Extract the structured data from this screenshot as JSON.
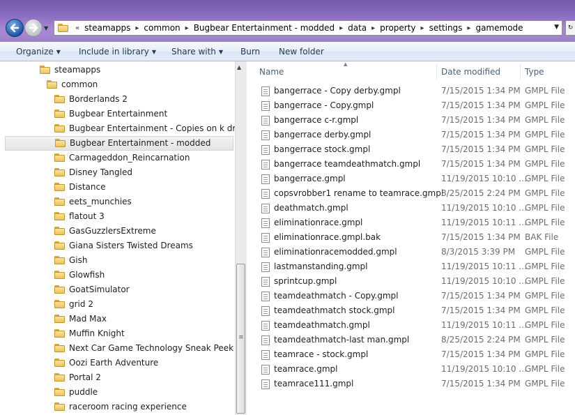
{
  "address": {
    "overflow_chevron": "«",
    "crumbs": [
      "steamapps",
      "common",
      "Bugbear Entertainment - modded",
      "data",
      "property",
      "settings",
      "gamemode"
    ]
  },
  "toolbar": {
    "organize": "Organize",
    "include_in_library": "Include in library",
    "share_with": "Share with",
    "burn": "Burn",
    "new_folder": "New folder"
  },
  "nav": {
    "items": [
      "steamapps",
      "common",
      "Borderlands 2",
      "Bugbear Entertainment",
      "Bugbear Entertainment - Copies on k drive",
      "Bugbear Entertainment - modded",
      "Carmageddon_Reincarnation",
      "Disney Tangled",
      "Distance",
      "eets_munchies",
      "flatout 3",
      "GasGuzzlersExtreme",
      "Giana Sisters Twisted Dreams",
      "Gish",
      "Glowfish",
      "GoatSimulator",
      "grid 2",
      "Mad Max",
      "Muffin Knight",
      "Next Car Game Technology Sneak Peek",
      "Oozi Earth Adventure",
      "Portal 2",
      "puddle",
      "raceroom racing experience"
    ]
  },
  "columns": {
    "name": "Name",
    "date": "Date modified",
    "type": "Type"
  },
  "files": [
    {
      "name": "bangerrace - Copy derby.gmpl",
      "date": "7/15/2015 1:34 PM",
      "type": "GMPL File"
    },
    {
      "name": "bangerrace - Copy.gmpl",
      "date": "7/15/2015 1:34 PM",
      "type": "GMPL File"
    },
    {
      "name": "bangerrace c-r.gmpl",
      "date": "7/15/2015 1:34 PM",
      "type": "GMPL File"
    },
    {
      "name": "bangerrace derby.gmpl",
      "date": "7/15/2015 1:34 PM",
      "type": "GMPL File"
    },
    {
      "name": "bangerrace stock.gmpl",
      "date": "7/15/2015 1:34 PM",
      "type": "GMPL File"
    },
    {
      "name": "bangerrace teamdeathmatch.gmpl",
      "date": "7/15/2015 1:34 PM",
      "type": "GMPL File"
    },
    {
      "name": "bangerrace.gmpl",
      "date": "11/19/2015 10:10 ...",
      "type": "GMPL File"
    },
    {
      "name": "copsvrobber1 rename to  teamrace.gmpl",
      "date": "8/25/2015 2:24 PM",
      "type": "GMPL File"
    },
    {
      "name": "deathmatch.gmpl",
      "date": "11/19/2015 10:10 ...",
      "type": "GMPL File"
    },
    {
      "name": "eliminationrace.gmpl",
      "date": "11/19/2015 10:11 ...",
      "type": "GMPL File"
    },
    {
      "name": "eliminationrace.gmpl.bak",
      "date": "7/15/2015 1:34 PM",
      "type": "BAK File"
    },
    {
      "name": "eliminationracemodded.gmpl",
      "date": "8/3/2015 3:39 PM",
      "type": "GMPL File"
    },
    {
      "name": "lastmanstanding.gmpl",
      "date": "11/19/2015 10:11 ...",
      "type": "GMPL File"
    },
    {
      "name": "sprintcup.gmpl",
      "date": "11/19/2015 10:10 ...",
      "type": "GMPL File"
    },
    {
      "name": "teamdeathmatch - Copy.gmpl",
      "date": "7/15/2015 1:34 PM",
      "type": "GMPL File"
    },
    {
      "name": "teamdeathmatch stock.gmpl",
      "date": "7/15/2015 1:34 PM",
      "type": "GMPL File"
    },
    {
      "name": "teamdeathmatch.gmpl",
      "date": "11/19/2015 10:11 ...",
      "type": "GMPL File"
    },
    {
      "name": "teamdeathmatch-last man.gmpl",
      "date": "8/25/2015 2:24 PM",
      "type": "GMPL File"
    },
    {
      "name": "teamrace - stock.gmpl",
      "date": "7/15/2015 1:34 PM",
      "type": "GMPL File"
    },
    {
      "name": "teamrace.gmpl",
      "date": "11/19/2015 10:10 ...",
      "type": "GMPL File"
    },
    {
      "name": "teamrace111.gmpl",
      "date": "7/15/2015 1:34 PM",
      "type": "GMPL File"
    }
  ],
  "colors": {
    "title_gradient": "#8a6bc0",
    "toolbar_text": "#1e395b",
    "header_text": "#4c607a"
  }
}
